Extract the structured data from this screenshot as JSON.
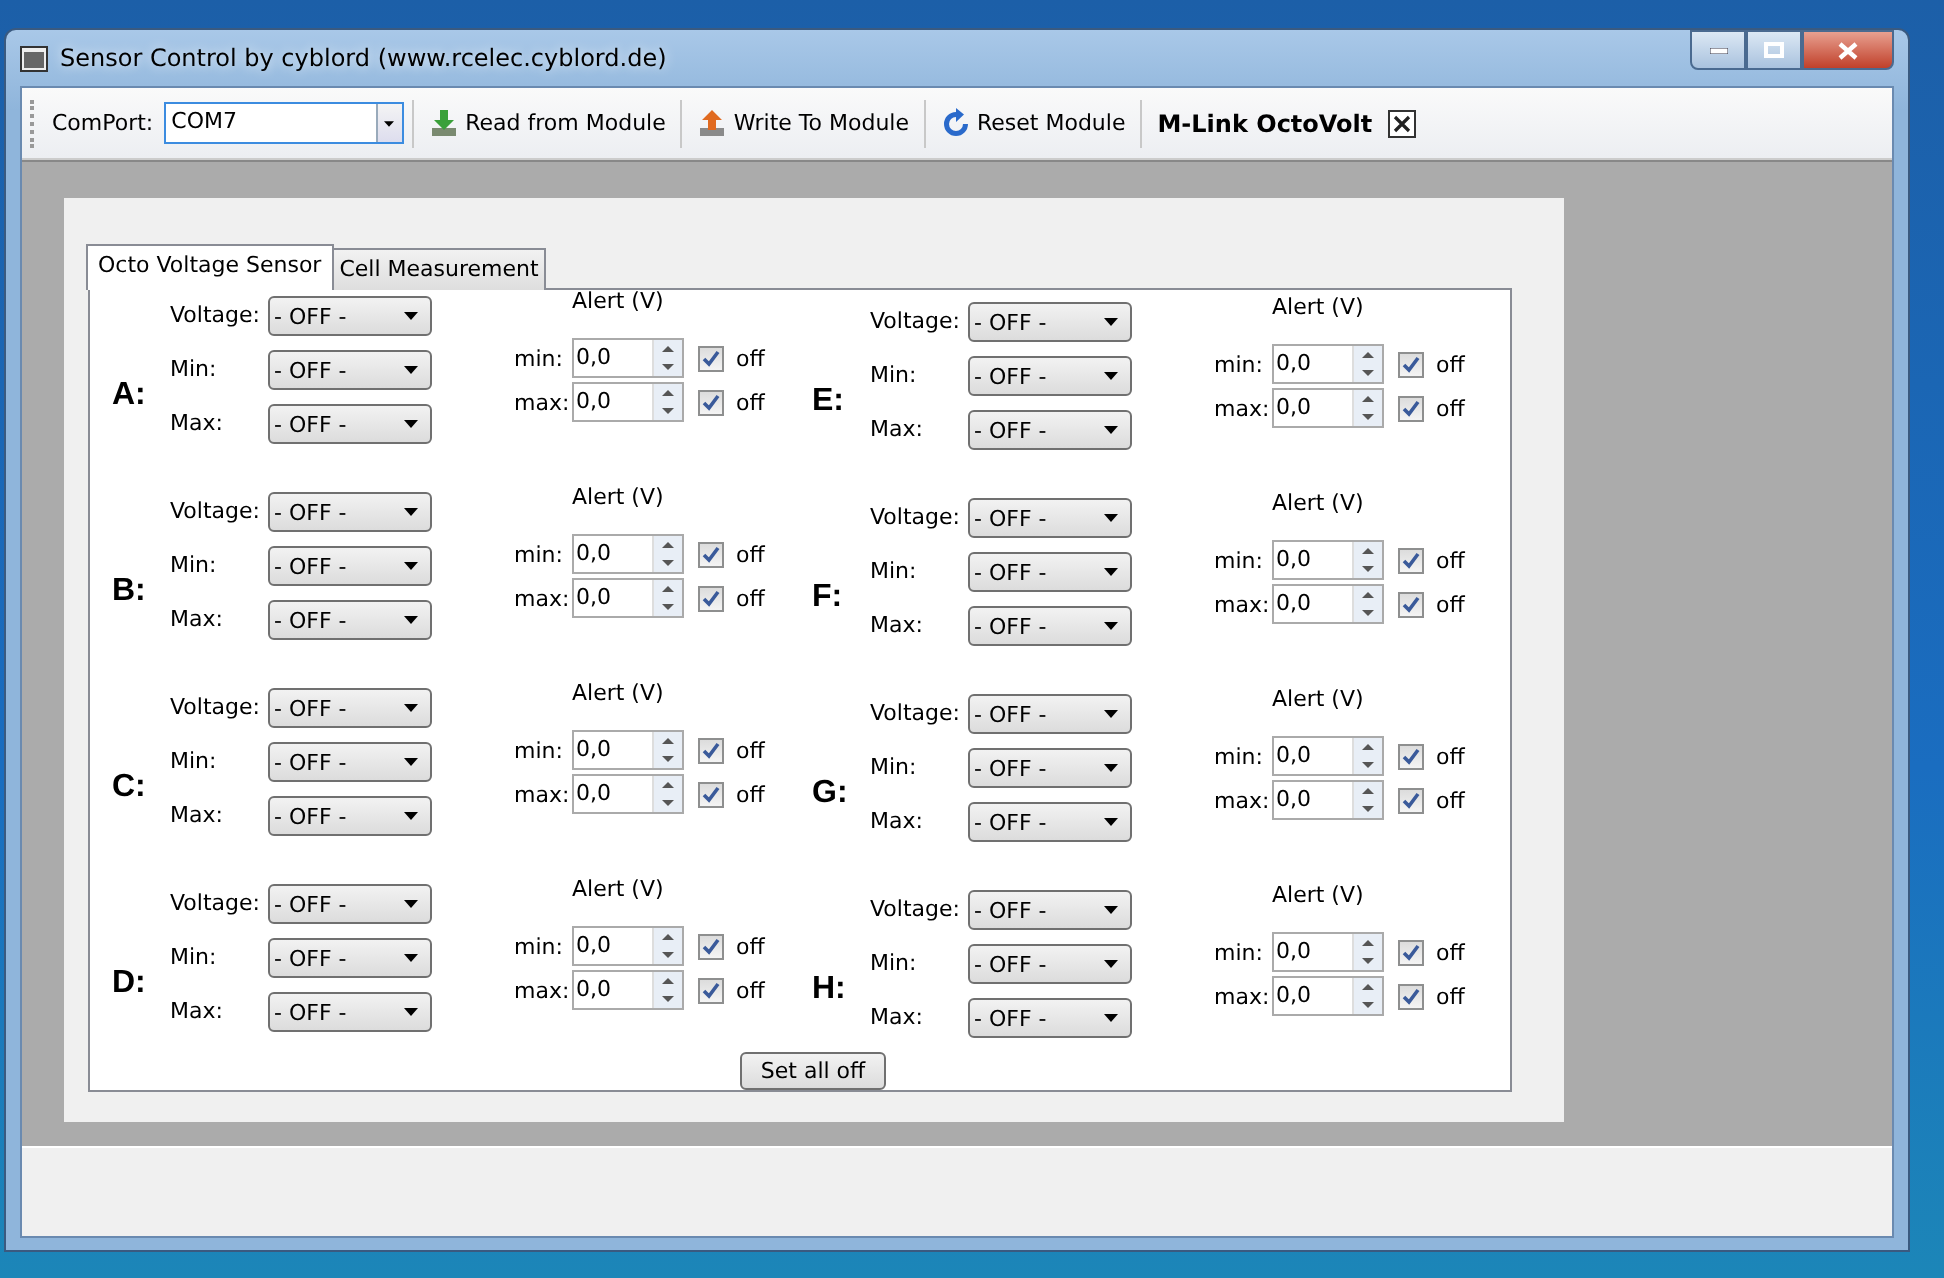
{
  "window": {
    "title": "Sensor Control by cyblord (www.rcelec.cyblord.de)"
  },
  "toolbar": {
    "comport_label": "ComPort:",
    "comport_value": "COM7",
    "buttons": [
      {
        "label": "Read from Module",
        "kind": "read"
      },
      {
        "label": "Write To Module",
        "kind": "write"
      },
      {
        "label": "Reset Module",
        "kind": "reset"
      }
    ],
    "module_name": "M-Link OctoVolt"
  },
  "tabs": [
    {
      "label": "Octo Voltage Sensor",
      "selected": true
    },
    {
      "label": "Cell Measurement",
      "selected": false
    }
  ],
  "sensors": [
    {
      "letter": "A:",
      "fields": [
        {
          "label": "Voltage:",
          "value": "- OFF -"
        },
        {
          "label": "Min:",
          "value": "- OFF -"
        },
        {
          "label": "Max:",
          "value": "- OFF -"
        }
      ],
      "alert_title": "Alert (V)",
      "alerts": [
        {
          "label": "min:",
          "value": "0,0",
          "checked": true,
          "check_label": "off"
        },
        {
          "label": "max:",
          "value": "0,0",
          "checked": true,
          "check_label": "off"
        }
      ]
    },
    {
      "letter": "E:",
      "fields": [
        {
          "label": "Voltage:",
          "value": "- OFF -"
        },
        {
          "label": "Min:",
          "value": "- OFF -"
        },
        {
          "label": "Max:",
          "value": "- OFF -"
        }
      ],
      "alert_title": "Alert (V)",
      "alerts": [
        {
          "label": "min:",
          "value": "0,0",
          "checked": true,
          "check_label": "off"
        },
        {
          "label": "max:",
          "value": "0,0",
          "checked": true,
          "check_label": "off"
        }
      ]
    },
    {
      "letter": "B:",
      "fields": [
        {
          "label": "Voltage:",
          "value": "- OFF -"
        },
        {
          "label": "Min:",
          "value": "- OFF -"
        },
        {
          "label": "Max:",
          "value": "- OFF -"
        }
      ],
      "alert_title": "Alert (V)",
      "alerts": [
        {
          "label": "min:",
          "value": "0,0",
          "checked": true,
          "check_label": "off"
        },
        {
          "label": "max:",
          "value": "0,0",
          "checked": true,
          "check_label": "off"
        }
      ]
    },
    {
      "letter": "F:",
      "fields": [
        {
          "label": "Voltage:",
          "value": "- OFF -"
        },
        {
          "label": "Min:",
          "value": "- OFF -"
        },
        {
          "label": "Max:",
          "value": "- OFF -"
        }
      ],
      "alert_title": "Alert (V)",
      "alerts": [
        {
          "label": "min:",
          "value": "0,0",
          "checked": true,
          "check_label": "off"
        },
        {
          "label": "max:",
          "value": "0,0",
          "checked": true,
          "check_label": "off"
        }
      ]
    },
    {
      "letter": "C:",
      "fields": [
        {
          "label": "Voltage:",
          "value": "- OFF -"
        },
        {
          "label": "Min:",
          "value": "- OFF -"
        },
        {
          "label": "Max:",
          "value": "- OFF -"
        }
      ],
      "alert_title": "Alert (V)",
      "alerts": [
        {
          "label": "min:",
          "value": "0,0",
          "checked": true,
          "check_label": "off"
        },
        {
          "label": "max:",
          "value": "0,0",
          "checked": true,
          "check_label": "off"
        }
      ]
    },
    {
      "letter": "G:",
      "fields": [
        {
          "label": "Voltage:",
          "value": "- OFF -"
        },
        {
          "label": "Min:",
          "value": "- OFF -"
        },
        {
          "label": "Max:",
          "value": "- OFF -"
        }
      ],
      "alert_title": "Alert (V)",
      "alerts": [
        {
          "label": "min:",
          "value": "0,0",
          "checked": true,
          "check_label": "off"
        },
        {
          "label": "max:",
          "value": "0,0",
          "checked": true,
          "check_label": "off"
        }
      ]
    },
    {
      "letter": "D:",
      "fields": [
        {
          "label": "Voltage:",
          "value": "- OFF -"
        },
        {
          "label": "Min:",
          "value": "- OFF -"
        },
        {
          "label": "Max:",
          "value": "- OFF -"
        }
      ],
      "alert_title": "Alert (V)",
      "alerts": [
        {
          "label": "min:",
          "value": "0,0",
          "checked": true,
          "check_label": "off"
        },
        {
          "label": "max:",
          "value": "0,0",
          "checked": true,
          "check_label": "off"
        }
      ]
    },
    {
      "letter": "H:",
      "fields": [
        {
          "label": "Voltage:",
          "value": "- OFF -"
        },
        {
          "label": "Min:",
          "value": "- OFF -"
        },
        {
          "label": "Max:",
          "value": "- OFF -"
        }
      ],
      "alert_title": "Alert (V)",
      "alerts": [
        {
          "label": "min:",
          "value": "0,0",
          "checked": true,
          "check_label": "off"
        },
        {
          "label": "max:",
          "value": "0,0",
          "checked": true,
          "check_label": "off"
        }
      ]
    }
  ],
  "set_all_off": "Set all off"
}
